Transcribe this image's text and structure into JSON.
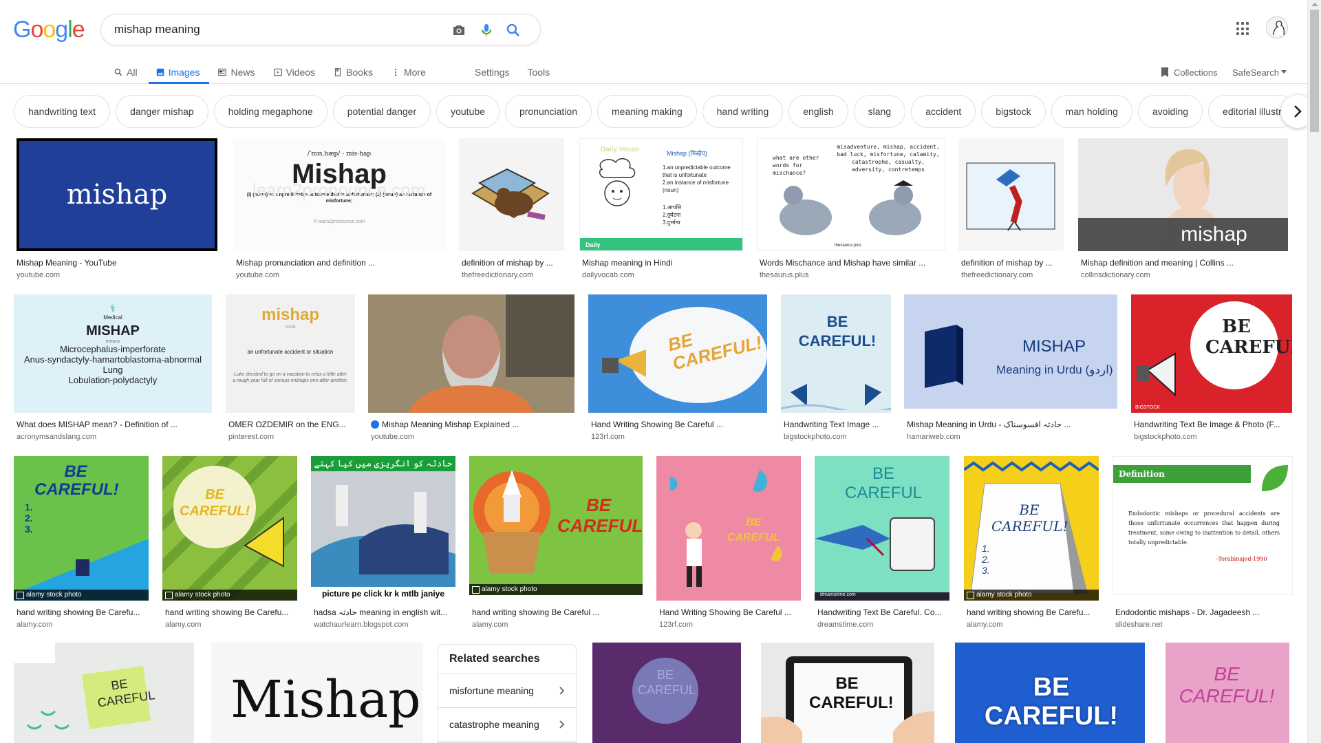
{
  "search": {
    "query": "mishap meaning"
  },
  "logo": {
    "letters": [
      "G",
      "o",
      "o",
      "g",
      "l",
      "e"
    ],
    "colors": [
      "#4285f4",
      "#ea4335",
      "#fbbc05",
      "#4285f4",
      "#34a853",
      "#ea4335"
    ]
  },
  "tabs": [
    {
      "label": "All",
      "icon": "search-icon"
    },
    {
      "label": "Images",
      "icon": "image-icon",
      "active": true
    },
    {
      "label": "News",
      "icon": "news-icon"
    },
    {
      "label": "Videos",
      "icon": "video-icon"
    },
    {
      "label": "Books",
      "icon": "book-icon"
    },
    {
      "label": "More",
      "icon": "more-vert-icon"
    }
  ],
  "tools": {
    "settings": "Settings",
    "tools": "Tools",
    "collections": "Collections",
    "safesearch": "SafeSearch"
  },
  "chips": [
    "handwriting text",
    "danger mishap",
    "holding megaphone",
    "potential danger",
    "youtube",
    "pronunciation",
    "meaning making",
    "hand writing",
    "english",
    "slang",
    "accident",
    "bigstock",
    "man holding",
    "avoiding",
    "editorial illustr"
  ],
  "results": [
    {
      "caption": "Mishap Meaning - YouTube",
      "source": "youtube.com",
      "text": "mishap"
    },
    {
      "caption": "Mishap pronunciation and definition ...",
      "source": "youtube.com",
      "text": "Mishap",
      "phonetic": "/ˈmɪs,hæp/ - mis-hap",
      "definition": "(i) (noun) an unpredictable outcome that is unfortunate; (2) (noun) an instance of misfortune;",
      "watermark": "learn2pronounce.com",
      "footer": "© learn2pronounce.com"
    },
    {
      "caption": "definition of mishap by ...",
      "source": "thefreedictionary.com"
    },
    {
      "caption": "Mishap meaning in Hindi",
      "source": "dailyvocab.com",
      "title": "Mishap (मिस्हैप)",
      "lines": [
        "1.an unpredictable outcome that is unfortunate",
        "2.an instance of misfortune (noun)",
        "1.आपत्ति",
        "2.दुर्घटना",
        "3.दुर्भाग्य"
      ],
      "brand": "Daily Vocab",
      "badge": "Daily"
    },
    {
      "caption": "Words Mischance and Mishap have similar ...",
      "source": "thesaurus.plus",
      "question": "what are other words for mischance?",
      "synonyms": "misadventure, mishap, accident, bad luck, misfortune, calamity, catastrophe, casualty, adversity, contretemps",
      "footer": "thesaurus.plus"
    },
    {
      "caption": "definition of mishap by ...",
      "source": "thefreedictionary.com"
    },
    {
      "caption": "Mishap definition and meaning | Collins ...",
      "source": "collinsdictionary.com",
      "text": "mishap"
    },
    {
      "caption": "What does MISHAP mean? - Definition of ...",
      "source": "acronymsandslang.com",
      "label": "Medical",
      "title": "MISHAP",
      "means": "means",
      "body": [
        "Microcephalus-imperforate",
        "Anus-syndactyly-hamartoblastoma-abnormal",
        "Lung",
        "Lobulation-polydactyly"
      ]
    },
    {
      "caption": "OMER OZDEMIR on the ENG...",
      "source": "pinterest.com",
      "title": "mishap",
      "pos": "noun",
      "def": "an unfortunate accident or situation",
      "example": "Luke decided to go on a vacation to relax a little after a rough year full of serious mishaps one after another."
    },
    {
      "caption": "Mishap Meaning Mishap Explained ...",
      "source": "youtube.com"
    },
    {
      "caption": "Hand Writing Showing Be Careful ...",
      "source": "123rf.com",
      "text": "BE CAREFUL!"
    },
    {
      "caption": "Handwriting Text Image ...",
      "source": "bigstockphoto.com",
      "text": "BE CAREFUL!"
    },
    {
      "caption": "Mishap Meaning in Urdu - حادثہ افسوسناک ...",
      "source": "hamariweb.com",
      "title": "MISHAP",
      "subtitle": "Meaning in Urdu (اردو)",
      "book": "DICTIONARY"
    },
    {
      "caption": "Handwriting Text Be Image & Photo (F...",
      "source": "bigstockphoto.com",
      "text": "BE CAREFUL!",
      "stamp": "BIGSTOCK"
    },
    {
      "caption": "hand writing showing Be Carefu...",
      "source": "alamy.com",
      "text": "BE CAREFUL!",
      "list": "1. 2. 3.",
      "stock": "alamy stock photo"
    },
    {
      "caption": "hand writing showing Be Carefu...",
      "source": "alamy.com",
      "text": "BE CAREFUL!",
      "stock": "alamy stock photo"
    },
    {
      "caption": "hadsa حادثہ meaning in english wit...",
      "source": "watchaurlearn.blogspot.com",
      "banner": "حادثہ کو انگریزی میں کیا کہتے ہیں",
      "footer": "picture pe click kr k mtlb janiye"
    },
    {
      "caption": "hand writing showing Be Careful ...",
      "source": "alamy.com",
      "text": "BE CAREFUL!",
      "stock": "alamy stock photo"
    },
    {
      "caption": "Hand Writing Showing Be Careful ...",
      "source": "123rf.com",
      "text": "BE CAREFUL"
    },
    {
      "caption": "Handwriting Text Be Careful. Co...",
      "source": "dreamstime.com",
      "text": "BE CAREFUL",
      "stamp": "dreamstime.com"
    },
    {
      "caption": "hand writing showing Be Carefu...",
      "source": "alamy.com",
      "text": "BE CAREFUL!",
      "list": "1. 2. 3.",
      "stock": "alamy stock photo"
    },
    {
      "caption": "Endodontic mishaps - Dr. Jagadeesh ...",
      "source": "slideshare.net",
      "label": "Definition",
      "body": "Endodontic mishaps or procedural accidents are those unfortunate occurrences that happen during treatment, some owing to inattention to detail, others totally unpredictable.",
      "cite": "-Torabinajed-1990"
    },
    {
      "text": "BE CAREFUL"
    },
    {
      "text": "Mishap"
    },
    {
      "text": "BE CAREFUL"
    },
    {
      "text": "BE CAREFUL!"
    },
    {
      "text": "BE CAREFUL!"
    },
    {
      "text": "BE CAREFUL!"
    }
  ],
  "related": {
    "title": "Related searches",
    "items": [
      "misfortune meaning",
      "catastrophe meaning"
    ]
  }
}
